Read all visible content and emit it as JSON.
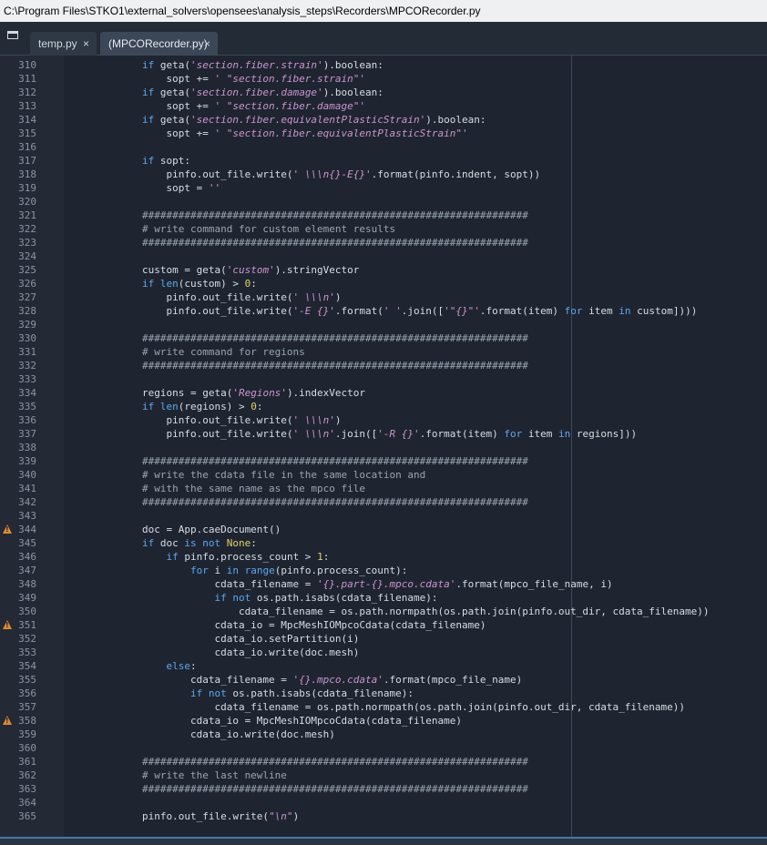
{
  "window": {
    "title": "C:\\Program Files\\STKO1\\external_solvers\\opensees\\analysis_steps\\Recorders\\MPCORecorder.py"
  },
  "tabs": [
    {
      "label": "temp.py",
      "close": "×",
      "active": false
    },
    {
      "label": "(MPCORecorder.py)",
      "close": "×",
      "active": true
    }
  ],
  "colors": {
    "keyword": "#5aa8f0",
    "string": "#cd93cf",
    "number": "#e2d06b",
    "comment": "#9aa5b1",
    "text": "#d7dde4",
    "warning": "#e28a2d"
  },
  "icons": {
    "panel": "panel-toggle-icon",
    "warning": "warning-icon",
    "close": "close-icon"
  },
  "editor": {
    "lines": [
      {
        "n": "310",
        "tokens": [
          [
            "        ",
            "p"
          ],
          [
            "if",
            "k"
          ],
          [
            " geta(",
            "p"
          ],
          [
            "'section.fiber.strain'",
            "s"
          ],
          [
            ").boolean:",
            "p"
          ]
        ]
      },
      {
        "n": "311",
        "tokens": [
          [
            "            sopt += ",
            "p"
          ],
          [
            "' \"section.fiber.strain\"'",
            "s"
          ]
        ]
      },
      {
        "n": "312",
        "tokens": [
          [
            "        ",
            "p"
          ],
          [
            "if",
            "k"
          ],
          [
            " geta(",
            "p"
          ],
          [
            "'section.fiber.damage'",
            "s"
          ],
          [
            ").boolean:",
            "p"
          ]
        ]
      },
      {
        "n": "313",
        "tokens": [
          [
            "            sopt += ",
            "p"
          ],
          [
            "' \"section.fiber.damage\"'",
            "s"
          ]
        ]
      },
      {
        "n": "314",
        "tokens": [
          [
            "        ",
            "p"
          ],
          [
            "if",
            "k"
          ],
          [
            " geta(",
            "p"
          ],
          [
            "'section.fiber.equivalentPlasticStrain'",
            "s"
          ],
          [
            ").boolean:",
            "p"
          ]
        ]
      },
      {
        "n": "315",
        "tokens": [
          [
            "            sopt += ",
            "p"
          ],
          [
            "' \"section.fiber.equivalentPlasticStrain\"'",
            "s"
          ]
        ]
      },
      {
        "n": "316",
        "tokens": []
      },
      {
        "n": "317",
        "tokens": [
          [
            "        ",
            "p"
          ],
          [
            "if",
            "k"
          ],
          [
            " sopt:",
            "p"
          ]
        ]
      },
      {
        "n": "318",
        "tokens": [
          [
            "            pinfo.out_file.write(",
            "p"
          ],
          [
            "' \\\\\\n{}-E{}'",
            "s"
          ],
          [
            ".format(pinfo.indent, sopt))",
            "p"
          ]
        ]
      },
      {
        "n": "319",
        "tokens": [
          [
            "            sopt = ",
            "p"
          ],
          [
            "''",
            "s"
          ]
        ]
      },
      {
        "n": "320",
        "tokens": []
      },
      {
        "n": "321",
        "tokens": [
          [
            "        ################################################################",
            "c"
          ]
        ]
      },
      {
        "n": "322",
        "tokens": [
          [
            "        # write command for custom element results",
            "c"
          ]
        ]
      },
      {
        "n": "323",
        "tokens": [
          [
            "        ################################################################",
            "c"
          ]
        ]
      },
      {
        "n": "324",
        "tokens": []
      },
      {
        "n": "325",
        "tokens": [
          [
            "        custom = geta(",
            "p"
          ],
          [
            "'custom'",
            "s"
          ],
          [
            ").stringVector",
            "p"
          ]
        ]
      },
      {
        "n": "326",
        "tokens": [
          [
            "        ",
            "p"
          ],
          [
            "if",
            "k"
          ],
          [
            " ",
            "p"
          ],
          [
            "len",
            "k"
          ],
          [
            "(custom) > ",
            "p"
          ],
          [
            "0",
            "n"
          ],
          [
            ":",
            "p"
          ]
        ]
      },
      {
        "n": "327",
        "tokens": [
          [
            "            pinfo.out_file.write(",
            "p"
          ],
          [
            "' \\\\\\n'",
            "s"
          ],
          [
            ")",
            "p"
          ]
        ]
      },
      {
        "n": "328",
        "tokens": [
          [
            "            pinfo.out_file.write(",
            "p"
          ],
          [
            "'-E {}'",
            "s"
          ],
          [
            ".format(",
            "p"
          ],
          [
            "' '",
            "s"
          ],
          [
            ".join([",
            "p"
          ],
          [
            "'\"{}\"'",
            "s"
          ],
          [
            ".format(item) ",
            "p"
          ],
          [
            "for",
            "k"
          ],
          [
            " item ",
            "p"
          ],
          [
            "in",
            "k"
          ],
          [
            " custom])))",
            "p"
          ]
        ]
      },
      {
        "n": "329",
        "tokens": []
      },
      {
        "n": "330",
        "tokens": [
          [
            "        ################################################################",
            "c"
          ]
        ]
      },
      {
        "n": "331",
        "tokens": [
          [
            "        # write command for regions",
            "c"
          ]
        ]
      },
      {
        "n": "332",
        "tokens": [
          [
            "        ################################################################",
            "c"
          ]
        ]
      },
      {
        "n": "333",
        "tokens": []
      },
      {
        "n": "334",
        "tokens": [
          [
            "        regions = geta(",
            "p"
          ],
          [
            "'Regions'",
            "s"
          ],
          [
            ").indexVector",
            "p"
          ]
        ]
      },
      {
        "n": "335",
        "tokens": [
          [
            "        ",
            "p"
          ],
          [
            "if",
            "k"
          ],
          [
            " ",
            "p"
          ],
          [
            "len",
            "k"
          ],
          [
            "(regions) > ",
            "p"
          ],
          [
            "0",
            "n"
          ],
          [
            ":",
            "p"
          ]
        ]
      },
      {
        "n": "336",
        "tokens": [
          [
            "            pinfo.out_file.write(",
            "p"
          ],
          [
            "' \\\\\\n'",
            "s"
          ],
          [
            ")",
            "p"
          ]
        ]
      },
      {
        "n": "337",
        "tokens": [
          [
            "            pinfo.out_file.write(",
            "p"
          ],
          [
            "' \\\\\\n'",
            "s"
          ],
          [
            ".join([",
            "p"
          ],
          [
            "'-R {}'",
            "s"
          ],
          [
            ".format(item) ",
            "p"
          ],
          [
            "for",
            "k"
          ],
          [
            " item ",
            "p"
          ],
          [
            "in",
            "k"
          ],
          [
            " regions]))",
            "p"
          ]
        ]
      },
      {
        "n": "338",
        "tokens": []
      },
      {
        "n": "339",
        "tokens": [
          [
            "        ################################################################",
            "c"
          ]
        ]
      },
      {
        "n": "340",
        "tokens": [
          [
            "        # write the cdata file in the same location and",
            "c"
          ]
        ]
      },
      {
        "n": "341",
        "tokens": [
          [
            "        # with the same name as the mpco file",
            "c"
          ]
        ]
      },
      {
        "n": "342",
        "tokens": [
          [
            "        ################################################################",
            "c"
          ]
        ]
      },
      {
        "n": "343",
        "tokens": []
      },
      {
        "n": "344",
        "warn": true,
        "tokens": [
          [
            "        doc = App.caeDocument()",
            "p"
          ]
        ]
      },
      {
        "n": "345",
        "tokens": [
          [
            "        ",
            "p"
          ],
          [
            "if",
            "k"
          ],
          [
            " doc ",
            "p"
          ],
          [
            "is not",
            "k"
          ],
          [
            " ",
            "p"
          ],
          [
            "None",
            "n"
          ],
          [
            ":",
            "p"
          ]
        ]
      },
      {
        "n": "346",
        "tokens": [
          [
            "            ",
            "p"
          ],
          [
            "if",
            "k"
          ],
          [
            " pinfo.process_count > ",
            "p"
          ],
          [
            "1",
            "n"
          ],
          [
            ":",
            "p"
          ]
        ]
      },
      {
        "n": "347",
        "tokens": [
          [
            "                ",
            "p"
          ],
          [
            "for",
            "k"
          ],
          [
            " i ",
            "p"
          ],
          [
            "in",
            "k"
          ],
          [
            " ",
            "p"
          ],
          [
            "range",
            "k"
          ],
          [
            "(pinfo.process_count):",
            "p"
          ]
        ]
      },
      {
        "n": "348",
        "tokens": [
          [
            "                    cdata_filename = ",
            "p"
          ],
          [
            "'{}.part-{}.mpco.cdata'",
            "s"
          ],
          [
            ".format(mpco_file_name, i)",
            "p"
          ]
        ]
      },
      {
        "n": "349",
        "tokens": [
          [
            "                    ",
            "p"
          ],
          [
            "if",
            "k"
          ],
          [
            " ",
            "p"
          ],
          [
            "not",
            "k"
          ],
          [
            " os.path.isabs(cdata_filename):",
            "p"
          ]
        ]
      },
      {
        "n": "350",
        "tokens": [
          [
            "                        cdata_filename = os.path.normpath(os.path.join(pinfo.out_dir, cdata_filename))",
            "p"
          ]
        ]
      },
      {
        "n": "351",
        "warn": true,
        "tokens": [
          [
            "                    cdata_io = MpcMeshIOMpcoCdata(cdata_filename)",
            "p"
          ]
        ]
      },
      {
        "n": "352",
        "tokens": [
          [
            "                    cdata_io.setPartition(i)",
            "p"
          ]
        ]
      },
      {
        "n": "353",
        "tokens": [
          [
            "                    cdata_io.write(doc.mesh)",
            "p"
          ]
        ]
      },
      {
        "n": "354",
        "tokens": [
          [
            "            ",
            "p"
          ],
          [
            "else",
            "k"
          ],
          [
            ":",
            "p"
          ]
        ]
      },
      {
        "n": "355",
        "tokens": [
          [
            "                cdata_filename = ",
            "p"
          ],
          [
            "'{}.mpco.cdata'",
            "s"
          ],
          [
            ".format(mpco_file_name)",
            "p"
          ]
        ]
      },
      {
        "n": "356",
        "tokens": [
          [
            "                ",
            "p"
          ],
          [
            "if",
            "k"
          ],
          [
            " ",
            "p"
          ],
          [
            "not",
            "k"
          ],
          [
            " os.path.isabs(cdata_filename):",
            "p"
          ]
        ]
      },
      {
        "n": "357",
        "tokens": [
          [
            "                    cdata_filename = os.path.normpath(os.path.join(pinfo.out_dir, cdata_filename))",
            "p"
          ]
        ]
      },
      {
        "n": "358",
        "warn": true,
        "tokens": [
          [
            "                cdata_io = MpcMeshIOMpcoCdata(cdata_filename)",
            "p"
          ]
        ]
      },
      {
        "n": "359",
        "tokens": [
          [
            "                cdata_io.write(doc.mesh)",
            "p"
          ]
        ]
      },
      {
        "n": "360",
        "tokens": []
      },
      {
        "n": "361",
        "tokens": [
          [
            "        ################################################################",
            "c"
          ]
        ]
      },
      {
        "n": "362",
        "tokens": [
          [
            "        # write the last newline",
            "c"
          ]
        ]
      },
      {
        "n": "363",
        "tokens": [
          [
            "        ################################################################",
            "c"
          ]
        ]
      },
      {
        "n": "364",
        "tokens": []
      },
      {
        "n": "365",
        "tokens": [
          [
            "        pinfo.out_file.write(",
            "p"
          ],
          [
            "\"\\n\"",
            "s"
          ],
          [
            ")",
            "p"
          ]
        ]
      }
    ]
  }
}
